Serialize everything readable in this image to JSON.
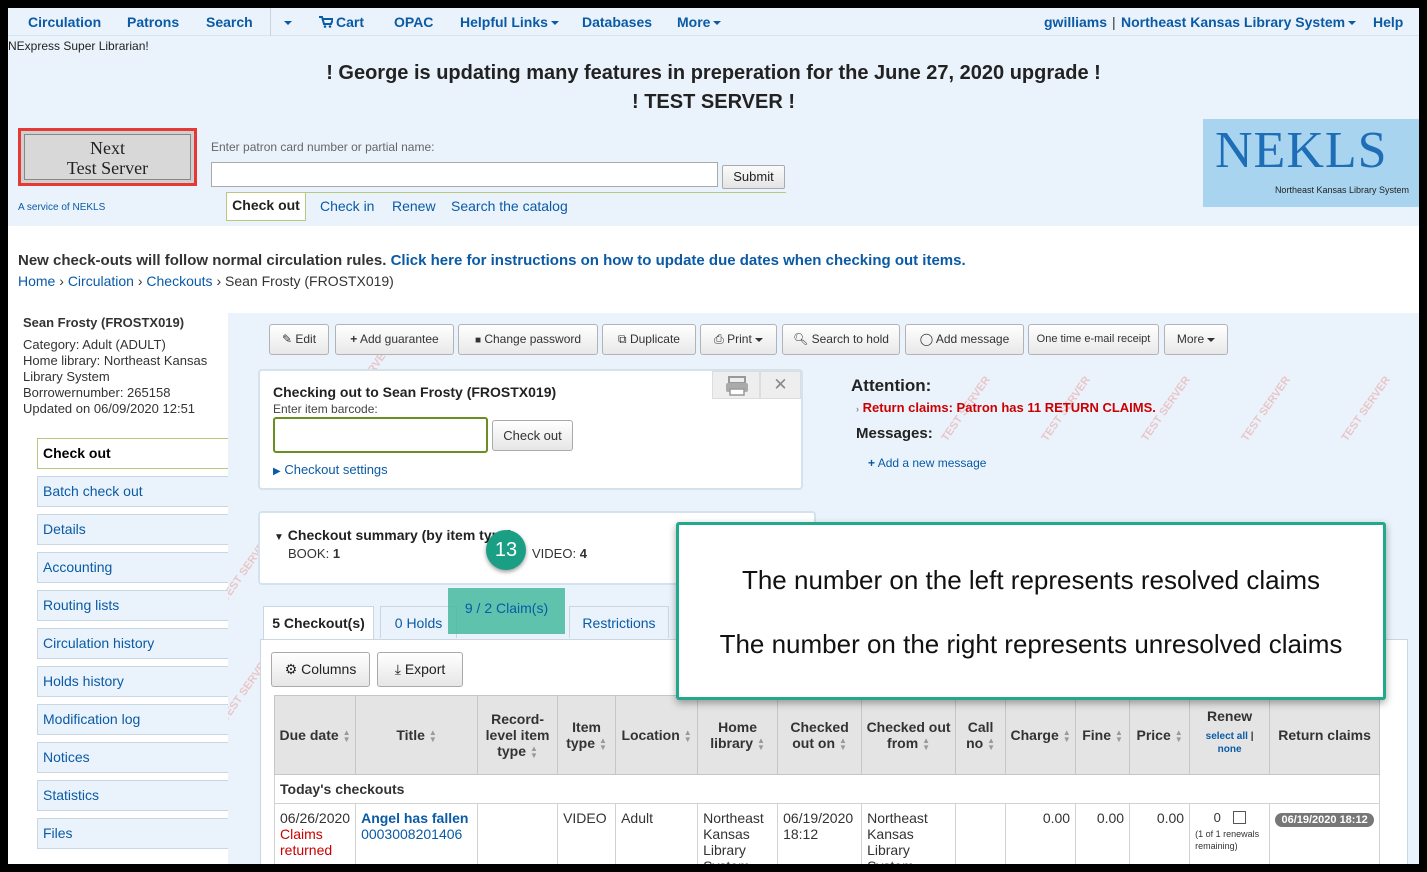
{
  "nav": {
    "items": [
      "Circulation",
      "Patrons",
      "Search",
      "Cart",
      "OPAC",
      "Helpful Links",
      "Databases",
      "More"
    ],
    "user": "gwilliams",
    "sep": "|",
    "library": "Northeast Kansas Library System",
    "help": "Help"
  },
  "header": {
    "super": "NExpress Super Librarian!",
    "banner1": "! George is updating many features in preperation for the June 27, 2020 upgrade !",
    "banner2": "! TEST SERVER !",
    "next_line1": "Next",
    "next_line2": "Test Server",
    "service": "A service of NEKLS",
    "patron_label": "Enter patron card number or partial name:",
    "submit": "Submit",
    "tabs": [
      "Check out",
      "Check in",
      "Renew",
      "Search the catalog"
    ],
    "logo": "NEKLS",
    "logo_sub": "Northeast Kansas Library System"
  },
  "notice": {
    "text": "New check-outs will follow normal circulation rules. ",
    "link": "Click here for instructions on how to update due dates when checking out items."
  },
  "breadcrumb": {
    "home": "Home",
    "circ": "Circulation",
    "checkouts": "Checkouts",
    "sep": "›",
    "current": "Sean Frosty (FROSTX019)"
  },
  "patron": {
    "name": "Sean Frosty (FROSTX019)",
    "category": "Category: Adult (ADULT)",
    "home_library": "Home library: Northeast Kansas Library System",
    "borrowernumber": "Borrowernumber: 265158",
    "updated": "Updated on 06/09/2020 12:51"
  },
  "sidebar": [
    "Check out",
    "Batch check out",
    "Details",
    "Accounting",
    "Routing lists",
    "Circulation history",
    "Holds history",
    "Modification log",
    "Notices",
    "Statistics",
    "Files"
  ],
  "toolbar": [
    "Edit",
    "Add guarantee",
    "Change password",
    "Duplicate",
    "Print",
    "Search to hold",
    "Add message",
    "One time e-mail receipt",
    "More"
  ],
  "checkout": {
    "title": "Checking out to Sean Frosty (FROSTX019)",
    "label": "Enter item barcode:",
    "button": "Check out",
    "settings": "Checkout settings"
  },
  "summary": {
    "title": "Checkout summary (by item type)",
    "book": "BOOK:",
    "book_count": "1",
    "video": "VIDEO:",
    "video_count": "4"
  },
  "badge": "13",
  "attention": {
    "title": "Attention:",
    "claims": "Return claims: Patron has 11 RETURN CLAIMS.",
    "messages": "Messages:",
    "add_message": "Add a new message"
  },
  "tabs": [
    "5 Checkout(s)",
    "0 Holds",
    "9 / 2 Claim(s)",
    "Restrictions"
  ],
  "table": {
    "columns_btn": "Columns",
    "export_btn": "Export",
    "headers": [
      "Due date",
      "Title",
      "Record-level item type",
      "Item type",
      "Location",
      "Home library",
      "Checked out on",
      "Checked out from",
      "Call no",
      "Charge",
      "Fine",
      "Price",
      "Renew",
      "Return claims"
    ],
    "renew_select_all": "select all",
    "renew_sep": "|",
    "renew_none": "none",
    "group": "Today's checkouts",
    "row": {
      "due": "06/26/2020",
      "due_status": "Claims returned",
      "title": "Angel has fallen",
      "barcode": "0003008201406",
      "rec_type": "",
      "item_type": "VIDEO",
      "location": "Adult",
      "home": "Northeast Kansas Library System",
      "checked_on": "06/19/2020 18:12",
      "checked_from": "Northeast Kansas Library System",
      "call": "",
      "charge": "0.00",
      "fine": "0.00",
      "price": "0.00",
      "renew_count": "0",
      "renew_note": "(1 of 1 renewals remaining)",
      "claim_date": "06/19/2020 18:12"
    }
  },
  "callout": {
    "line1": "The number on the left represents resolved claims",
    "line2": "The number on the right represents unresolved claims"
  },
  "watermark": "TEST SERVER",
  "colors": {
    "accent": "#0a5aa6",
    "highlight": "#46b99e",
    "callout_border": "#22a88a",
    "alert": "#cc0000"
  }
}
